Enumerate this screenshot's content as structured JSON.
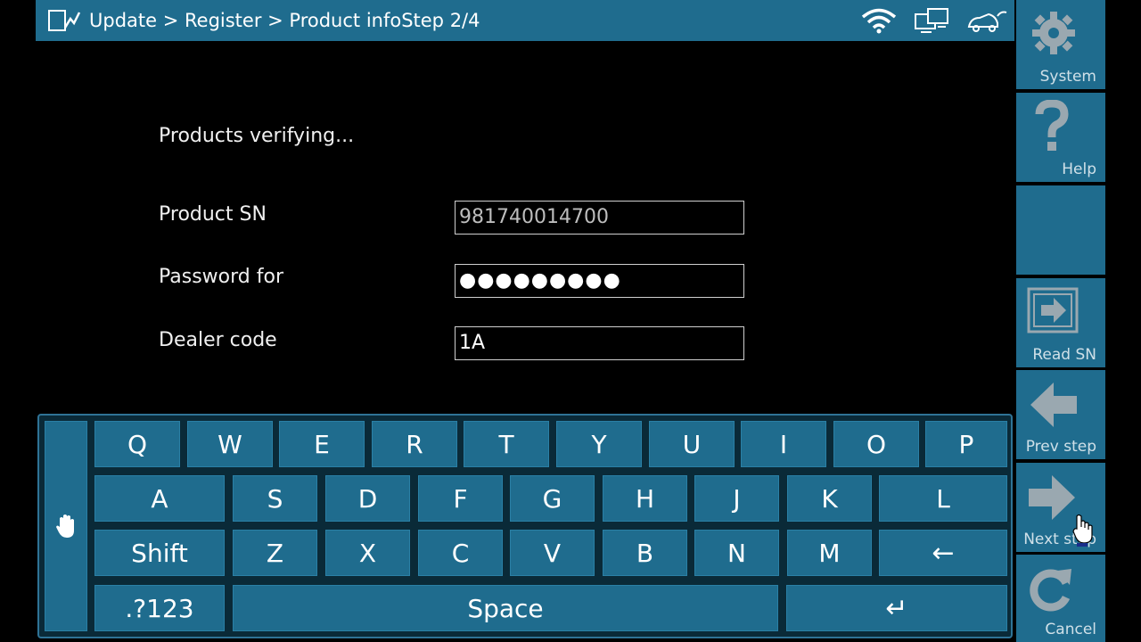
{
  "header": {
    "title": "Update > Register > Product infoStep 2/4",
    "icons": [
      "edit-chart-icon",
      "wifi-icon",
      "network-icon",
      "vehicle-icon"
    ]
  },
  "main": {
    "status": "Products verifying...",
    "fields": {
      "product_sn": {
        "label": "Product SN",
        "value": "981740014700"
      },
      "password": {
        "label": "Password for",
        "value": "●●●●●●●●●"
      },
      "dealer_code": {
        "label": "Dealer code",
        "value": "1A"
      }
    }
  },
  "keyboard": {
    "row1": [
      "Q",
      "W",
      "E",
      "R",
      "T",
      "Y",
      "U",
      "I",
      "O",
      "P"
    ],
    "row2": [
      "A",
      "S",
      "D",
      "F",
      "G",
      "H",
      "J",
      "K",
      "L"
    ],
    "row3": [
      "Shift",
      "Z",
      "X",
      "C",
      "V",
      "B",
      "N",
      "M",
      "←"
    ],
    "row4": [
      ".?123",
      "Space",
      "↵"
    ],
    "side_icon": "hand-icon"
  },
  "sidebar": {
    "system": "System",
    "help": "Help",
    "read_sn": "Read SN",
    "prev_step": "Prev step",
    "next_step": "Next step",
    "cancel": "Cancel"
  },
  "colors": {
    "panel": "#1f6c8e",
    "background": "#000000",
    "keyboard_bg": "#0a2a38"
  }
}
